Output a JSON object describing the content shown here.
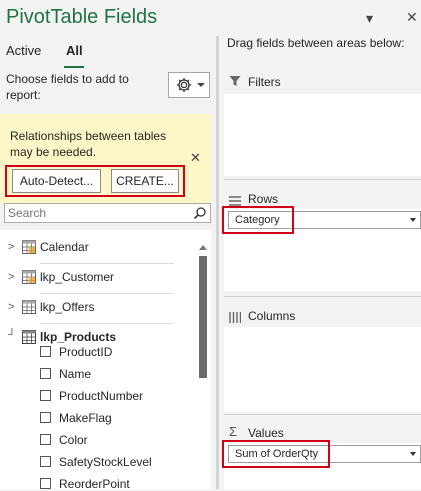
{
  "header": {
    "title": "PivotTable Fields",
    "menu_glyph": "▾",
    "close_glyph": "✕"
  },
  "tabs": [
    {
      "label": "Active"
    },
    {
      "label": "All",
      "active": true
    }
  ],
  "choose_fields_text": "Choose fields to add to report:",
  "relationships_notice": {
    "text": "Relationships between tables may be needed.",
    "close_glyph": "✕",
    "auto_detect_label": "Auto-Detect...",
    "create_label": "CREATE..."
  },
  "search": {
    "placeholder": "Search",
    "value": ""
  },
  "field_list": {
    "tables": [
      {
        "name": "Calendar",
        "expanded": false
      },
      {
        "name": "lkp_Customer",
        "expanded": false
      },
      {
        "name": "lkp_Offers",
        "expanded": false
      },
      {
        "name": "lkp_Products",
        "expanded": true
      }
    ],
    "product_fields": [
      "ProductID",
      "Name",
      "ProductNumber",
      "MakeFlag",
      "Color",
      "SafetyStockLevel",
      "ReorderPoint"
    ]
  },
  "areas": {
    "hint": "Drag fields between areas below:",
    "filters_label": "Filters",
    "rows_label": "Rows",
    "rows_items": [
      "Category"
    ],
    "columns_label": "Columns",
    "values_label": "Values",
    "values_items": [
      "Sum of OrderQty"
    ]
  },
  "colors": {
    "accent": "#217346",
    "highlight": "#d0021b",
    "notice_bg": "#fdf6c7"
  }
}
